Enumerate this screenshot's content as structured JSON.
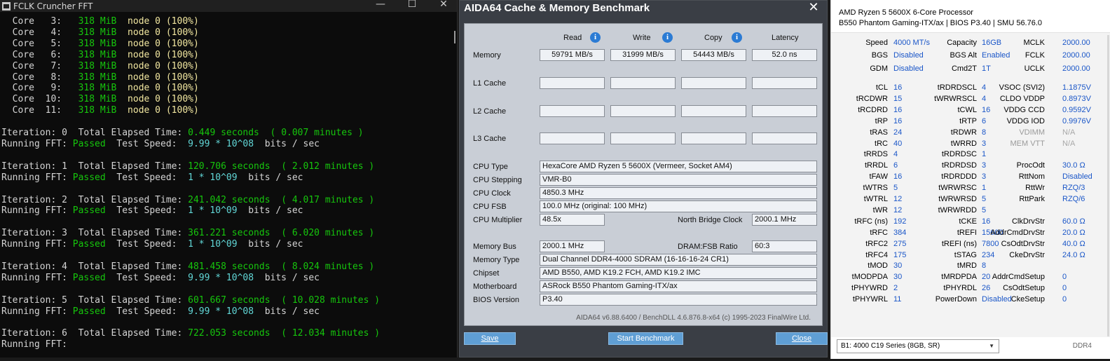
{
  "terminal": {
    "title": "FCLK Cruncher FFT",
    "minimize_icon": "—",
    "maximize_icon": "☐",
    "close_icon": "✕",
    "core_lines": [
      {
        "label": "Core   3:",
        "mem": "318 MiB",
        "node": "node 0 (100%)"
      },
      {
        "label": "Core   4:",
        "mem": "318 MiB",
        "node": "node 0 (100%)"
      },
      {
        "label": "Core   5:",
        "mem": "318 MiB",
        "node": "node 0 (100%)"
      },
      {
        "label": "Core   6:",
        "mem": "318 MiB",
        "node": "node 0 (100%)"
      },
      {
        "label": "Core   7:",
        "mem": "318 MiB",
        "node": "node 0 (100%)"
      },
      {
        "label": "Core   8:",
        "mem": "318 MiB",
        "node": "node 0 (100%)"
      },
      {
        "label": "Core   9:",
        "mem": "318 MiB",
        "node": "node 0 (100%)"
      },
      {
        "label": "Core  10:",
        "mem": "318 MiB",
        "node": "node 0 (100%)"
      },
      {
        "label": "Core  11:",
        "mem": "318 MiB",
        "node": "node 0 (100%)"
      }
    ],
    "iterations": [
      {
        "n": "0",
        "seconds": "0.449 seconds",
        "minutes": "( 0.007 minutes )",
        "status": "Passed",
        "speed": "9.99 * 10^08"
      },
      {
        "n": "1",
        "seconds": "120.706 seconds",
        "minutes": "( 2.012 minutes )",
        "status": "Passed",
        "speed": "1 * 10^09"
      },
      {
        "n": "2",
        "seconds": "241.042 seconds",
        "minutes": "( 4.017 minutes )",
        "status": "Passed",
        "speed": "1 * 10^09"
      },
      {
        "n": "3",
        "seconds": "361.221 seconds",
        "minutes": "( 6.020 minutes )",
        "status": "Passed",
        "speed": "1 * 10^09"
      },
      {
        "n": "4",
        "seconds": "481.458 seconds",
        "minutes": "( 8.024 minutes )",
        "status": "Passed",
        "speed": "9.99 * 10^08"
      },
      {
        "n": "5",
        "seconds": "601.667 seconds",
        "minutes": "( 10.028 minutes )",
        "status": "Passed",
        "speed": "9.99 * 10^08"
      },
      {
        "n": "6",
        "seconds": "722.053 seconds",
        "minutes": "( 12.034 minutes )",
        "status": "",
        "speed": ""
      }
    ],
    "iteration_word": "Iteration:",
    "elapsed_word": "Total Elapsed Time:",
    "running_word": "Running FFT:",
    "speed_word": "Test Speed:",
    "units_word": "bits / sec"
  },
  "aida": {
    "title": "AIDA64 Cache & Memory Benchmark",
    "close_icon": "✕",
    "info_icon": "i",
    "headers": {
      "read": "Read",
      "write": "Write",
      "copy": "Copy",
      "latency": "Latency"
    },
    "rows": [
      {
        "label": "Memory",
        "read": "59791 MB/s",
        "write": "31999 MB/s",
        "copy": "54443 MB/s",
        "latency": "52.0 ns"
      },
      {
        "label": "L1 Cache",
        "read": "",
        "write": "",
        "copy": "",
        "latency": ""
      },
      {
        "label": "L2 Cache",
        "read": "",
        "write": "",
        "copy": "",
        "latency": ""
      },
      {
        "label": "L3 Cache",
        "read": "",
        "write": "",
        "copy": "",
        "latency": ""
      }
    ],
    "cpu": {
      "type_label": "CPU Type",
      "type": "HexaCore AMD Ryzen 5 5600X  (Vermeer, Socket AM4)",
      "stepping_label": "CPU Stepping",
      "stepping": "VMR-B0",
      "clock_label": "CPU Clock",
      "clock": "4850.3 MHz",
      "fsb_label": "CPU FSB",
      "fsb": "100.0 MHz  (original: 100 MHz)",
      "mult_label": "CPU Multiplier",
      "mult": "48.5x",
      "nb_label": "North Bridge Clock",
      "nb": "2000.1 MHz"
    },
    "mem": {
      "bus_label": "Memory Bus",
      "bus": "2000.1 MHz",
      "ratio_label": "DRAM:FSB Ratio",
      "ratio": "60:3",
      "type_label": "Memory Type",
      "type": "Dual Channel DDR4-4000 SDRAM  (16-16-16-24 CR1)",
      "chipset_label": "Chipset",
      "chipset": "AMD B550, AMD K19.2 FCH, AMD K19.2 IMC",
      "mobo_label": "Motherboard",
      "mobo": "ASRock B550 Phantom Gaming-ITX/ax",
      "bios_label": "BIOS Version",
      "bios": "P3.40"
    },
    "footer": "AIDA64 v6.88.6400 / BenchDLL 4.6.876.8-x64  (c) 1995-2023 FinalWire Ltd.",
    "buttons": {
      "save": "Save",
      "start": "Start Benchmark",
      "close": "Close"
    }
  },
  "zen": {
    "cpu": "AMD Ryzen 5 5600X 6-Core Processor",
    "board": "B550 Phantom Gaming-ITX/ax | BIOS P3.40 | SMU 56.76.0",
    "rows_top": [
      [
        "Speed",
        "4000 MT/s",
        "Capacity",
        "16GB",
        "MCLK",
        "2000.00"
      ],
      [
        "BGS",
        "Disabled",
        "BGS Alt",
        "Enabled",
        "FCLK",
        "2000.00"
      ],
      [
        "GDM",
        "Disabled",
        "Cmd2T",
        "1T",
        "UCLK",
        "2000.00"
      ]
    ],
    "rows_timing": [
      [
        "tCL",
        "16",
        "tRDRDSCL",
        "4",
        "VSOC (SVI2)",
        "1.1875V"
      ],
      [
        "tRCDWR",
        "15",
        "tWRWRSCL",
        "4",
        "CLDO VDDP",
        "0.8973V"
      ],
      [
        "tRCDRD",
        "16",
        "tCWL",
        "16",
        "VDDG CCD",
        "0.9592V"
      ],
      [
        "tRP",
        "16",
        "tRTP",
        "6",
        "VDDG IOD",
        "0.9976V"
      ],
      [
        "tRAS",
        "24",
        "tRDWR",
        "8",
        "VDIMM",
        "N/A"
      ],
      [
        "tRC",
        "40",
        "tWRRD",
        "3",
        "MEM VTT",
        "N/A"
      ],
      [
        "tRRDS",
        "4",
        "tRDRDSC",
        "1",
        "",
        ""
      ],
      [
        "tRRDL",
        "6",
        "tRDRDSD",
        "3",
        "ProcOdt",
        "30.0 Ω"
      ],
      [
        "tFAW",
        "16",
        "tRDRDDD",
        "3",
        "RttNom",
        "Disabled"
      ],
      [
        "tWTRS",
        "5",
        "tWRWRSC",
        "1",
        "RttWr",
        "RZQ/3"
      ],
      [
        "tWTRL",
        "12",
        "tWRWRSD",
        "5",
        "RttPark",
        "RZQ/6"
      ],
      [
        "tWR",
        "12",
        "tWRWRDD",
        "5",
        "",
        ""
      ],
      [
        "tRFC (ns)",
        "192",
        "tCKE",
        "16",
        "ClkDrvStr",
        "60.0 Ω"
      ],
      [
        "tRFC",
        "384",
        "tREFI",
        "15600",
        "AddrCmdDrvStr",
        "20.0 Ω"
      ],
      [
        "tRFC2",
        "275",
        "tREFI (ns)",
        "7800",
        "CsOdtDrvStr",
        "40.0 Ω"
      ],
      [
        "tRFC4",
        "175",
        "tSTAG",
        "234",
        "CkeDrvStr",
        "24.0 Ω"
      ],
      [
        "tMOD",
        "30",
        "tMRD",
        "8",
        "",
        ""
      ],
      [
        "tMODPDA",
        "30",
        "tMRDPDA",
        "20",
        "AddrCmdSetup",
        "0"
      ],
      [
        "tPHYWRD",
        "2",
        "tPHYRDL",
        "26",
        "CsOdtSetup",
        "0"
      ],
      [
        "tPHYWRL",
        "11",
        "PowerDown",
        "Disabled",
        "CkeSetup",
        "0"
      ]
    ],
    "select_value": "B1: 4000 C19 Series (8GB, SR)",
    "select_arrow": "▼",
    "ddr_label": "DDR4"
  },
  "colors": {
    "terminal_bg": "#0c0c0c",
    "terminal_green": "#16c60c",
    "terminal_cyan": "#61d6d6",
    "aida_bg": "#3a3e45",
    "aida_button": "#5f9ed4",
    "zen_value": "#1a56c8"
  }
}
